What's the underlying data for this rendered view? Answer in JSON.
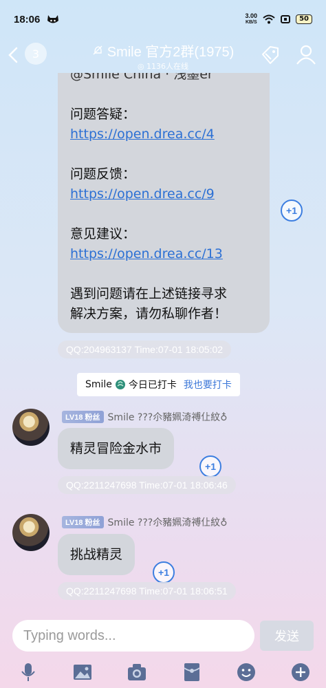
{
  "status_bar": {
    "time": "18:06",
    "speed_value": "3.00",
    "speed_unit": "KB/S",
    "battery": "50"
  },
  "header": {
    "unread_count": "3",
    "title": "Smile 官方2群(1975)",
    "online": "1136人在线"
  },
  "top_message": {
    "lines": [
      {
        "text": "@Smile China · 浅墨er",
        "type": "cut"
      },
      {
        "text": "",
        "type": "blank"
      },
      {
        "text": "问题答疑：",
        "type": "text"
      },
      {
        "text": "https://open.drea.cc/4",
        "type": "link"
      },
      {
        "text": "",
        "type": "blank"
      },
      {
        "text": "问题反馈：",
        "type": "text"
      },
      {
        "text": "https://open.drea.cc/9",
        "type": "link"
      },
      {
        "text": "",
        "type": "blank"
      },
      {
        "text": "意见建议：",
        "type": "text"
      },
      {
        "text": "https://open.drea.cc/13",
        "type": "link"
      },
      {
        "text": "",
        "type": "blank"
      },
      {
        "text": "遇到问题请在上述链接寻求",
        "type": "text"
      },
      {
        "text": "解决方案，请勿私聊作者！",
        "type": "text"
      }
    ],
    "meta": "QQ:204963137  Time:07-01 18:05:02",
    "plus_one": "+1"
  },
  "system_message": {
    "name": "Smile",
    "text": "今日已打卡",
    "action": "我也要打卡"
  },
  "messages": [
    {
      "level": "LV18",
      "badge": "粉丝",
      "sender": "Smile ???尒豬姵渏禣仩紋♁",
      "text": "精灵冒险金水市",
      "meta": "QQ:2211247698  Time:07-01 18:06:46",
      "plus_one": "+1"
    },
    {
      "level": "LV18",
      "badge": "粉丝",
      "sender": "Smile ???尒豬姵渏禣仩紋♁",
      "text": "挑战精灵",
      "meta": "QQ:2211247698  Time:07-01 18:06:51",
      "plus_one": "+1"
    }
  ],
  "input": {
    "placeholder": "Typing words...",
    "send_label": "发送"
  },
  "toolbar": {
    "icons": [
      "microphone-icon",
      "image-icon",
      "camera-icon",
      "red-packet-icon",
      "emoji-icon",
      "plus-icon"
    ]
  }
}
